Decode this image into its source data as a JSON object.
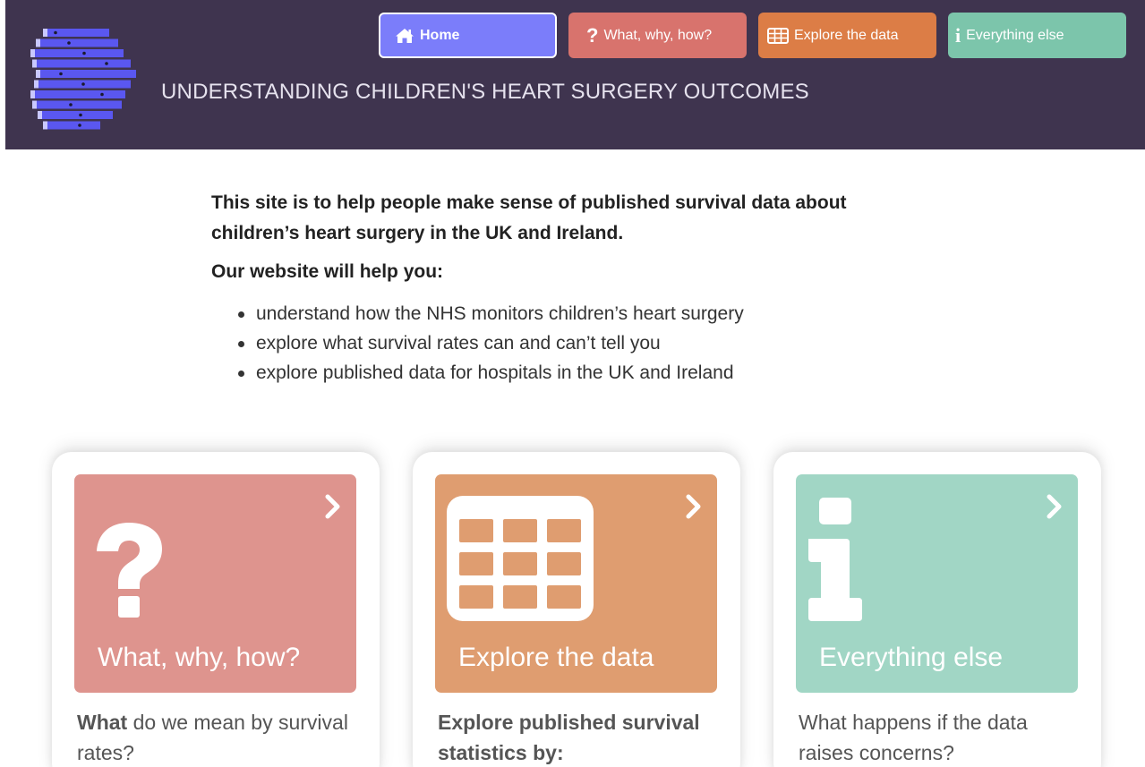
{
  "header": {
    "site_title": "UNDERSTANDING CHILDREN'S HEART SURGERY OUTCOMES",
    "nav": [
      {
        "label": "Home",
        "icon": "home-icon"
      },
      {
        "label": "What, why, how?",
        "icon": "question-icon"
      },
      {
        "label": "Explore the data",
        "icon": "table-icon"
      },
      {
        "label": "Everything else",
        "icon": "info-icon"
      }
    ]
  },
  "intro": {
    "lead": "This site is to help people make sense of published survival data about children’s heart surgery in the UK and Ireland.",
    "sub": "Our website will help you:",
    "bullets": [
      "understand how the NHS monitors children’s heart surgery",
      "explore what survival rates can and can’t tell you",
      "explore published data for hospitals in the UK and Ireland"
    ]
  },
  "cards": [
    {
      "title": "What, why, how?",
      "icon": "question-icon",
      "text_bold": "What",
      "text_rest": " do we mean by survival rates?"
    },
    {
      "title": "Explore the data",
      "icon": "table-icon",
      "text_bold": "Explore published survival statistics by:",
      "text_rest": ""
    },
    {
      "title": "Everything else",
      "icon": "info-icon",
      "text_bold": "",
      "text_rest": "What happens if the data raises concerns?"
    }
  ],
  "colors": {
    "header_bg": "#3f344f",
    "home": "#7b7dfa",
    "what": "#d8736d",
    "explore": "#dc7d46",
    "else": "#7cc5ab",
    "tile_what": "#de948e",
    "tile_explore": "#df9d70",
    "tile_else": "#a1d6c5"
  }
}
